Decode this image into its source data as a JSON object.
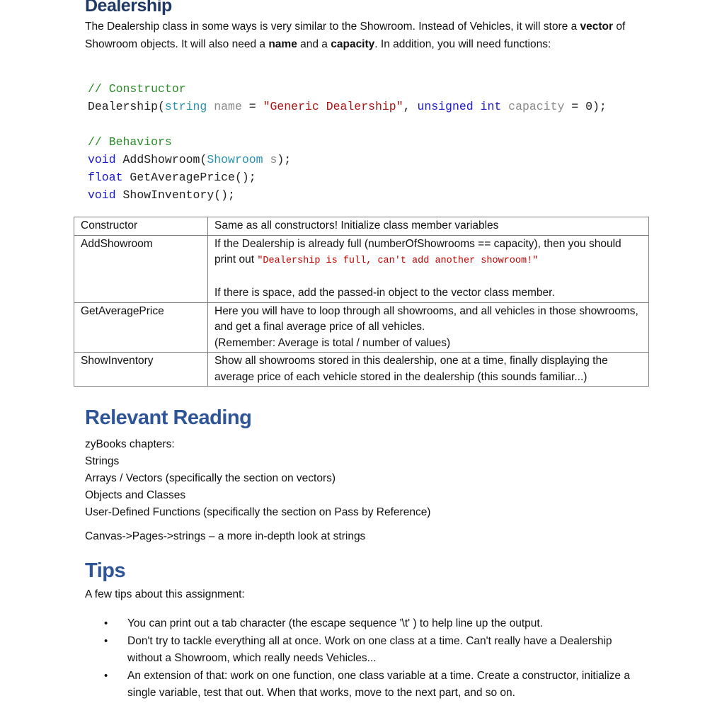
{
  "dealership": {
    "heading": "Dealership",
    "intro": {
      "part1": "The Dealership class in some ways is very similar to the Showroom. Instead of Vehicles, it will store a ",
      "bold1": "vector",
      "part2": " of Showroom objects. It will also need a ",
      "bold2": "name",
      "part3": " and a ",
      "bold3": "capacity",
      "part4": ". In addition, you will need functions:"
    },
    "code": {
      "ctor_comment": "// Constructor",
      "ctor_name": "Dealership(",
      "ctor_type1": "string",
      "ctor_param1": " name",
      "ctor_eq1": " = ",
      "ctor_default1": "\"Generic Dealership\"",
      "ctor_comma": ", ",
      "ctor_type2": "unsigned int",
      "ctor_param2": " capacity",
      "ctor_eq2": " = 0);",
      "beh_comment": "// Behaviors",
      "line1_kw": "void",
      "line1_name": " AddShowroom(",
      "line1_type": "Showroom",
      "line1_param": " s",
      "line1_end": ");",
      "line2_kw": "float",
      "line2_rest": " GetAveragePrice();",
      "line3_kw": "void",
      "line3_rest": " ShowInventory();"
    },
    "table": [
      {
        "name": "Constructor",
        "desc": "Same as all constructors! Initialize class member variables"
      },
      {
        "name": "AddShowroom",
        "desc_a": "If the Dealership is already full (numberOfShowrooms == capacity), then you should print out ",
        "desc_code": "\"Dealership is full, can't add another showroom!\"",
        "desc_b": "If there is space, add the passed-in object to the vector class member."
      },
      {
        "name": "GetAveragePrice",
        "desc_a": "Here you will have to loop through all showrooms, and all vehicles in those showrooms, and get a final average price of all vehicles.",
        "desc_b": "(Remember: Average is total / number of values)"
      },
      {
        "name": "ShowInventory",
        "desc": "Show all showrooms stored in this dealership, one at a time, finally displaying the average price of each vehicle stored in the dealership (this sounds familiar...)"
      }
    ]
  },
  "reading": {
    "heading": "Relevant Reading",
    "items": [
      "zyBooks chapters:",
      "Strings",
      "Arrays / Vectors (specifically the section on vectors)",
      "Objects and Classes",
      "User-Defined Functions (specifically the section on Pass by Reference)"
    ],
    "canvas": "Canvas->Pages->strings – a more in-depth look at strings"
  },
  "tips": {
    "heading": "Tips",
    "intro": "A few tips about this assignment:",
    "bullet_glyph": "•",
    "items": [
      "You can print out a tab character (the escape sequence '\\t' ) to help line up the output.",
      "Don't try to tackle everything all at once. Work on one class at a time. Can't really have a Dealership without a Showroom, which really needs Vehicles...",
      "An extension of that: work on one function, one class variable at a time. Create a constructor, initialize a single variable, test that out. When that works, move to the next part, and so on."
    ]
  }
}
